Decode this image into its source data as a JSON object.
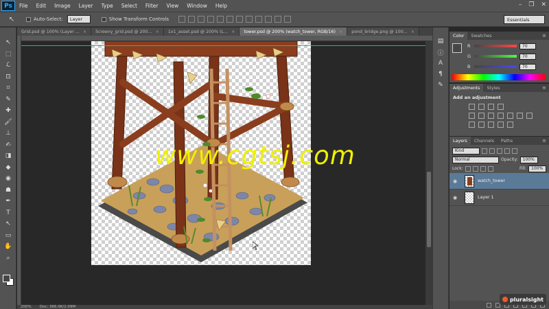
{
  "app": {
    "logo": "Ps",
    "menu": [
      "File",
      "Edit",
      "Image",
      "Layer",
      "Type",
      "Select",
      "Filter",
      "View",
      "Window",
      "Help"
    ]
  },
  "window_controls": {
    "minimize": "–",
    "restore": "❐",
    "close": "✕"
  },
  "options_bar": {
    "tool_glyph": "↖",
    "auto_select_label": "Auto-Select:",
    "auto_select_value": "Layer",
    "transform_label": "Show Transform Controls",
    "workspace": "Essentials"
  },
  "tools": [
    "↖",
    "⬚",
    "ℒ",
    "⊡",
    "⌗",
    "✎",
    "✚",
    "🖌",
    "⊥",
    "✍",
    "◨",
    "◆",
    "◉",
    "☗",
    "✒",
    "T",
    "↖",
    "▭",
    "✋",
    "⌕"
  ],
  "tabs": [
    {
      "label": "Grid.psd @ 100% (Layer ..."
    },
    {
      "label": "Screeny_grid.psd @ 200..."
    },
    {
      "label": "1x1_asset.psd @ 200% (L..."
    },
    {
      "label": "tower.psd @ 200% (watch_tower, RGB/16)",
      "active": true
    },
    {
      "label": "pond_bridge.png @ 100..."
    }
  ],
  "tab_close": "×",
  "watermark": "www.cgtsj.com",
  "status": {
    "zoom": "200%",
    "doc": "Doc: 366.0K/2.09M"
  },
  "color_panel": {
    "tabs": [
      "Color",
      "Swatches"
    ],
    "channels": [
      {
        "label": "R",
        "value": "70"
      },
      {
        "label": "G",
        "value": "70"
      },
      {
        "label": "B",
        "value": "70"
      }
    ]
  },
  "adjustments_panel": {
    "tabs": [
      "Adjustments",
      "Styles"
    ],
    "title": "Add an adjustment"
  },
  "layers_panel": {
    "tabs": [
      "Layers",
      "Channels",
      "Paths"
    ],
    "filter_kind": "Kind",
    "blend_mode": "Normal",
    "opacity_label": "Opacity:",
    "opacity_value": "100%",
    "lock_label": "Lock:",
    "fill_label": "Fill:",
    "fill_value": "100%",
    "layers": [
      {
        "name": "watch_tower",
        "selected": true
      },
      {
        "name": "Layer 1",
        "selected": false
      }
    ]
  },
  "brand": "pluralsight",
  "colors": {
    "ps_blue": "#31a8ff",
    "guide": "#00c8a0",
    "watermark": "#f0f000",
    "layer_selected": "#5a7a98",
    "wood": "#8a3e1e"
  }
}
